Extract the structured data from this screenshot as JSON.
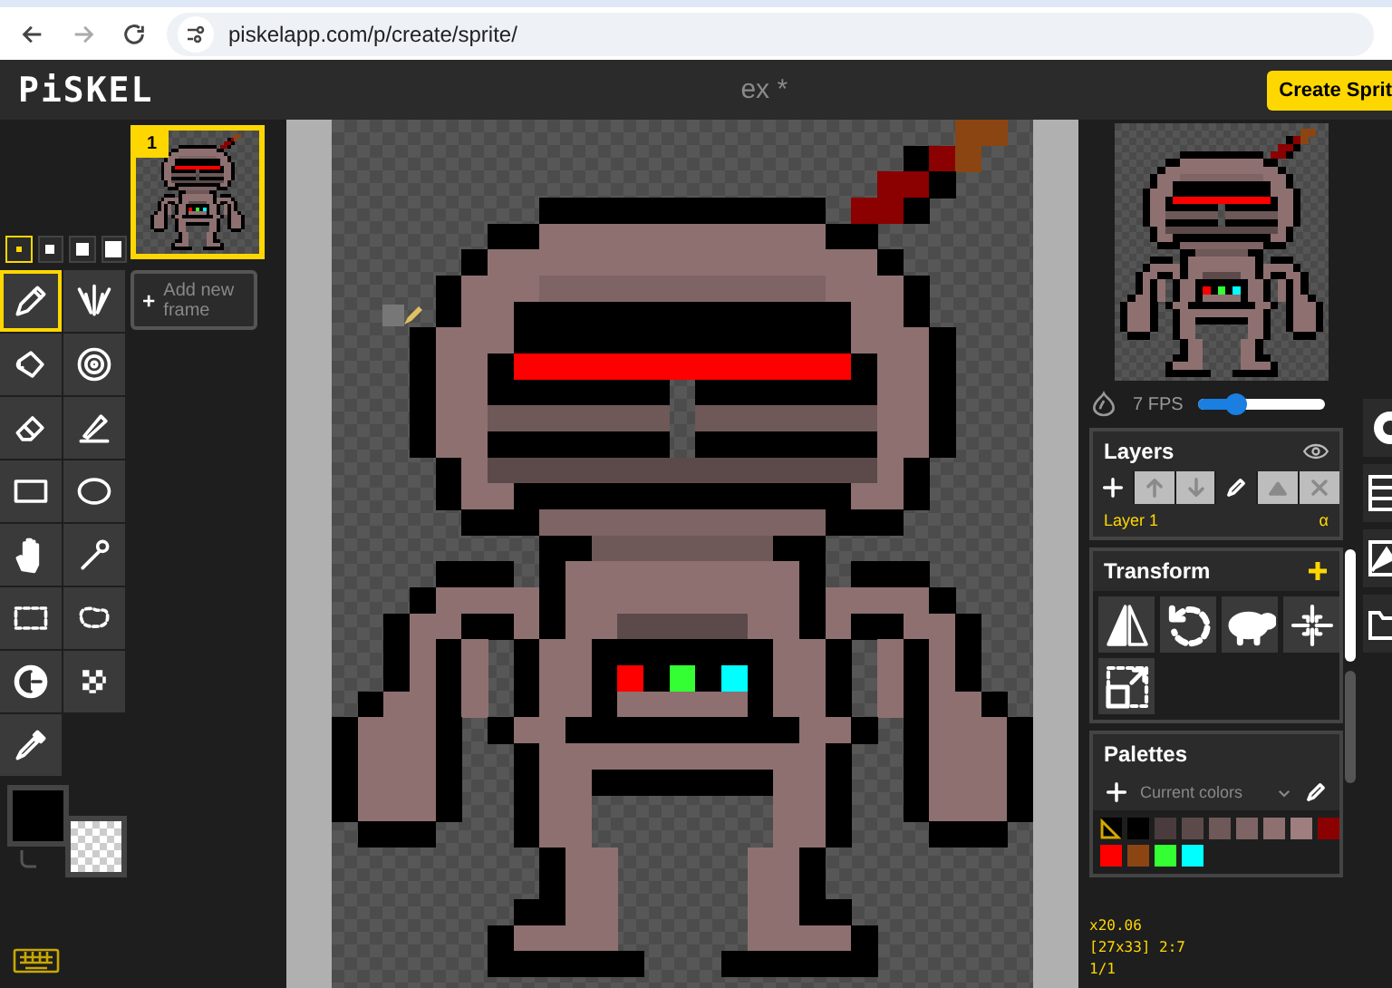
{
  "browser": {
    "url": "piskelapp.com/p/create/sprite/"
  },
  "header": {
    "logo": "PiSKEL",
    "title": "ex *",
    "create_button": "Create Sprit"
  },
  "pen_sizes": [
    {
      "selected": true
    },
    {
      "selected": false
    },
    {
      "selected": false
    },
    {
      "selected": false
    }
  ],
  "tools": [
    {
      "kind": "pen",
      "selected": true
    },
    {
      "kind": "mirror",
      "selected": false
    },
    {
      "kind": "bucket",
      "selected": false
    },
    {
      "kind": "samecolor",
      "selected": false
    },
    {
      "kind": "eraser",
      "selected": false
    },
    {
      "kind": "stroke",
      "selected": false
    },
    {
      "kind": "rectangle",
      "selected": false
    },
    {
      "kind": "ellipse",
      "selected": false
    },
    {
      "kind": "move",
      "selected": false
    },
    {
      "kind": "wand",
      "selected": false
    },
    {
      "kind": "select",
      "selected": false
    },
    {
      "kind": "lasso",
      "selected": false
    },
    {
      "kind": "lighten",
      "selected": false
    },
    {
      "kind": "dither",
      "selected": false
    },
    {
      "kind": "picker",
      "selected": false
    }
  ],
  "colors": {
    "primary": {
      "color": "#000000"
    }
  },
  "frames": [
    {
      "number": "1",
      "selected": true
    }
  ],
  "add_frame": "Add new frame",
  "preview": {
    "fps": "7 FPS",
    "level": 0.3
  },
  "layers": {
    "title": "Layers",
    "buttons": [
      {
        "kind": "add",
        "disabled": false
      },
      {
        "kind": "up",
        "disabled": true
      },
      {
        "kind": "down",
        "disabled": true
      },
      {
        "kind": "edit",
        "disabled": false
      },
      {
        "kind": "merge",
        "disabled": true
      },
      {
        "kind": "delete",
        "disabled": true
      }
    ],
    "items": [
      {
        "name": "Layer 1",
        "alpha": "α",
        "selected": true
      }
    ]
  },
  "transform": {
    "title": "Transform",
    "tools": [
      {
        "kind": "flip"
      },
      {
        "kind": "rotate"
      },
      {
        "kind": "clone"
      },
      {
        "kind": "center"
      },
      {
        "kind": "resize"
      }
    ]
  },
  "palettes": {
    "title": "Palettes",
    "current": "Current colors",
    "colors": [
      {
        "color": "#000000"
      },
      {
        "color": "#4a3c3c"
      },
      {
        "color": "#5c4a4a"
      },
      {
        "color": "#6e5858"
      },
      {
        "color": "#7e6464"
      },
      {
        "color": "#8e7070"
      },
      {
        "color": "#9e7e7e"
      },
      {
        "color": "#8b0000"
      },
      {
        "color": "#ff0000"
      },
      {
        "color": "#8b4513"
      },
      {
        "color": "#33ff33"
      },
      {
        "color": "#00ffff"
      }
    ]
  },
  "status": {
    "zoom": "x20.06",
    "size": "[27x33] 2:7",
    "frames": "1/1"
  }
}
